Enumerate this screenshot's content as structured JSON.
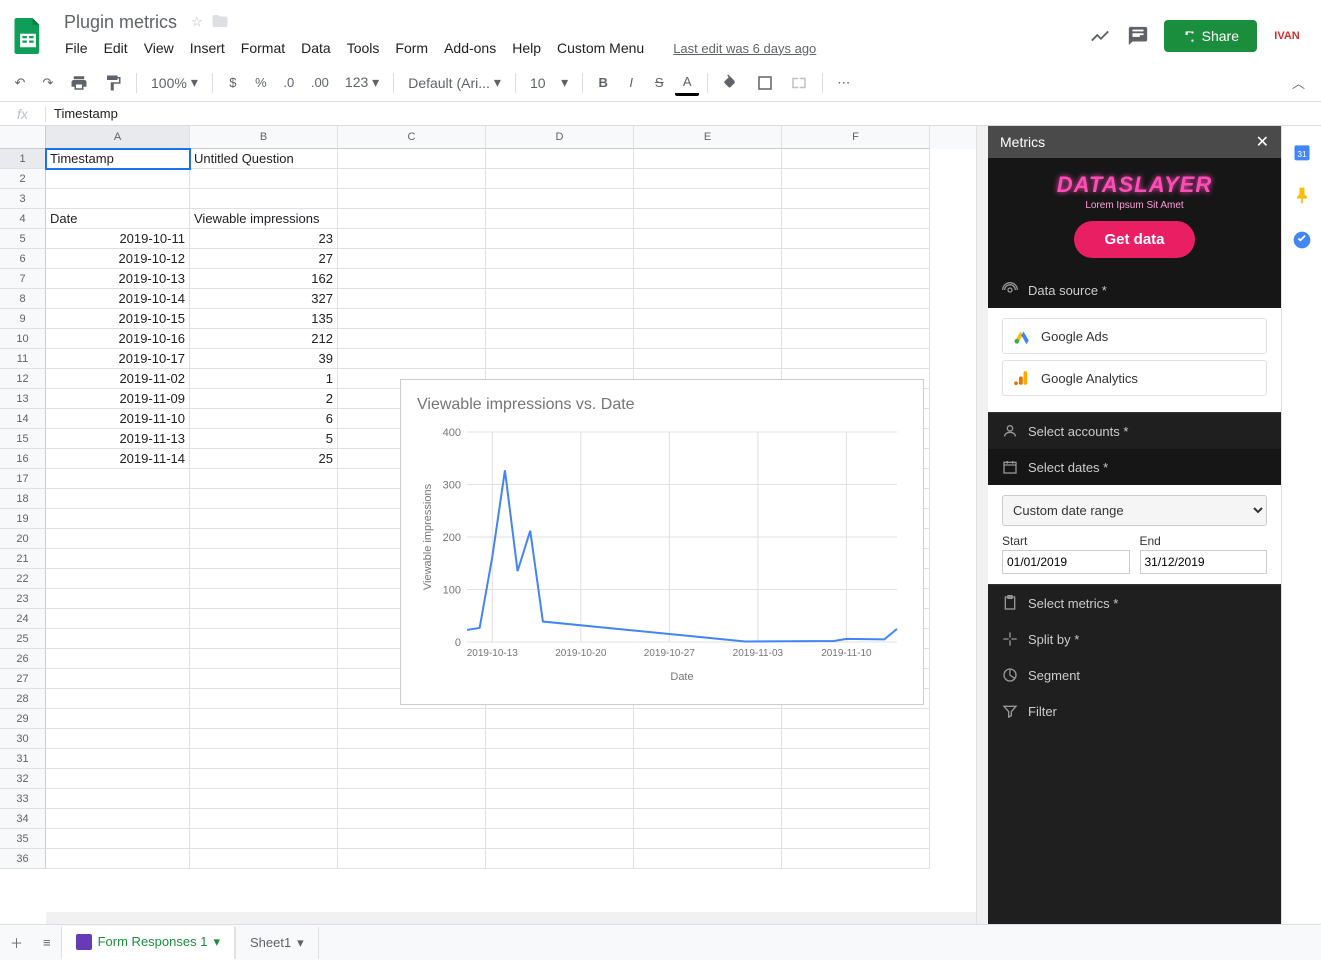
{
  "doc": {
    "title": "Plugin metrics",
    "last_edit": "Last edit was 6 days ago"
  },
  "menus": [
    "File",
    "Edit",
    "View",
    "Insert",
    "Format",
    "Data",
    "Tools",
    "Form",
    "Add-ons",
    "Help",
    "Custom Menu"
  ],
  "share_label": "Share",
  "toolbar": {
    "zoom": "100%",
    "font": "Default (Ari...",
    "size": "10"
  },
  "formula": {
    "value": "Timestamp"
  },
  "columns": [
    "A",
    "B",
    "C",
    "D",
    "E",
    "F"
  ],
  "cells": {
    "A1": "Timestamp",
    "B1": "Untitled Question",
    "A4": "Date",
    "B4": "Viewable impressions",
    "A5": "2019-10-11",
    "B5": "23",
    "A6": "2019-10-12",
    "B6": "27",
    "A7": "2019-10-13",
    "B7": "162",
    "A8": "2019-10-14",
    "B8": "327",
    "A9": "2019-10-15",
    "B9": "135",
    "A10": "2019-10-16",
    "B10": "212",
    "A11": "2019-10-17",
    "B11": "39",
    "A12": "2019-11-02",
    "B12": "1",
    "A13": "2019-11-09",
    "B13": "2",
    "A14": "2019-11-10",
    "B14": "6",
    "A15": "2019-11-13",
    "B15": "5",
    "A16": "2019-11-14",
    "B16": "25"
  },
  "chart_data": {
    "type": "line",
    "title": "Viewable impressions vs. Date",
    "xlabel": "Date",
    "ylabel": "Viewable impressions",
    "ylim": [
      0,
      400
    ],
    "x_ticks": [
      "2019-10-13",
      "2019-10-20",
      "2019-10-27",
      "2019-11-03",
      "2019-11-10"
    ],
    "x": [
      "2019-10-11",
      "2019-10-12",
      "2019-10-13",
      "2019-10-14",
      "2019-10-15",
      "2019-10-16",
      "2019-10-17",
      "2019-11-02",
      "2019-11-09",
      "2019-11-10",
      "2019-11-13",
      "2019-11-14"
    ],
    "values": [
      23,
      27,
      162,
      327,
      135,
      212,
      39,
      1,
      2,
      6,
      5,
      25
    ]
  },
  "sidebar": {
    "title": "Metrics",
    "brand": "DATASLAYER",
    "brand_sub": "Lorem Ipsum Sit Amet",
    "get_data": "Get data",
    "sections": {
      "datasource": "Data source *",
      "accounts": "Select accounts *",
      "dates": "Select dates *",
      "metrics": "Select metrics *",
      "split": "Split by *",
      "segment": "Segment",
      "filter": "Filter"
    },
    "datasources": [
      "Google Ads",
      "Google Analytics"
    ],
    "date_range_label": "Custom date range",
    "start_label": "Start",
    "end_label": "End",
    "start": "01/01/2019",
    "end": "31/12/2019"
  },
  "tabs": {
    "active": "Form Responses 1",
    "other": "Sheet1"
  }
}
